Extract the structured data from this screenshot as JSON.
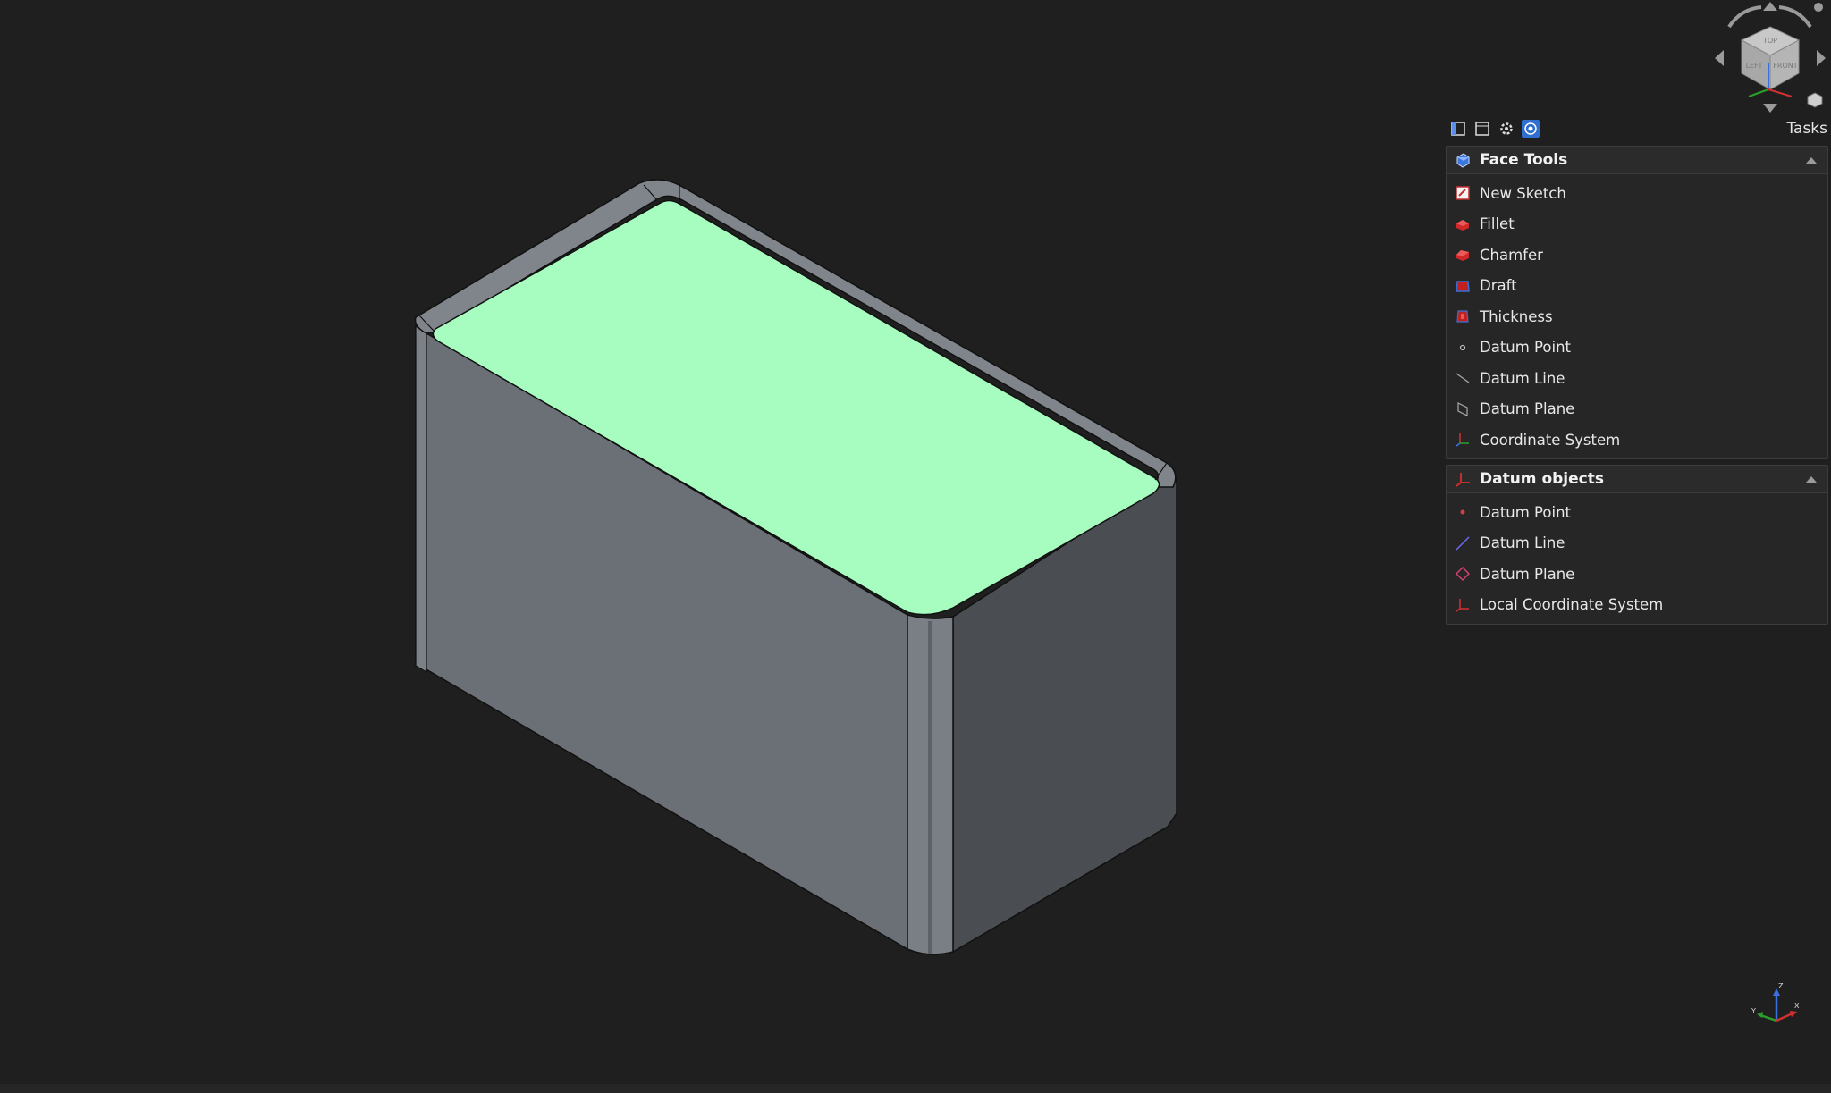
{
  "tasks_panel": {
    "title": "Tasks",
    "toolbar_icons": [
      "combo-view-icon",
      "window-icon",
      "settings-gear-icon",
      "view-eye-icon"
    ],
    "face_tools": {
      "title": "Face Tools",
      "items": [
        {
          "label": "New Sketch",
          "icon": "new-sketch-icon"
        },
        {
          "label": "Fillet",
          "icon": "fillet-icon"
        },
        {
          "label": "Chamfer",
          "icon": "chamfer-icon"
        },
        {
          "label": "Draft",
          "icon": "draft-icon"
        },
        {
          "label": "Thickness",
          "icon": "thickness-icon"
        },
        {
          "label": "Datum Point",
          "icon": "datum-point-icon"
        },
        {
          "label": "Datum Line",
          "icon": "datum-line-icon"
        },
        {
          "label": "Datum Plane",
          "icon": "datum-plane-icon"
        },
        {
          "label": "Coordinate System",
          "icon": "coordinate-system-icon"
        }
      ]
    },
    "datum_objects": {
      "title": "Datum objects",
      "items": [
        {
          "label": "Datum Point",
          "icon": "datum-point-icon"
        },
        {
          "label": "Datum Line",
          "icon": "datum-line-icon"
        },
        {
          "label": "Datum Plane",
          "icon": "datum-plane-icon"
        },
        {
          "label": "Local Coordinate System",
          "icon": "local-coordinate-system-icon"
        }
      ]
    }
  },
  "navigation_cube": {
    "faces": [
      "TOP",
      "LEFT",
      "FRONT"
    ]
  },
  "axis_gizmo": {
    "labels": [
      "Z",
      "Y",
      "X"
    ]
  },
  "colors": {
    "background": "#1f1f1f",
    "selected_face": "#a6fdbf",
    "body_front": "#6b6f76",
    "body_side": "#4a4d51",
    "accent": "#2e6fd0"
  }
}
